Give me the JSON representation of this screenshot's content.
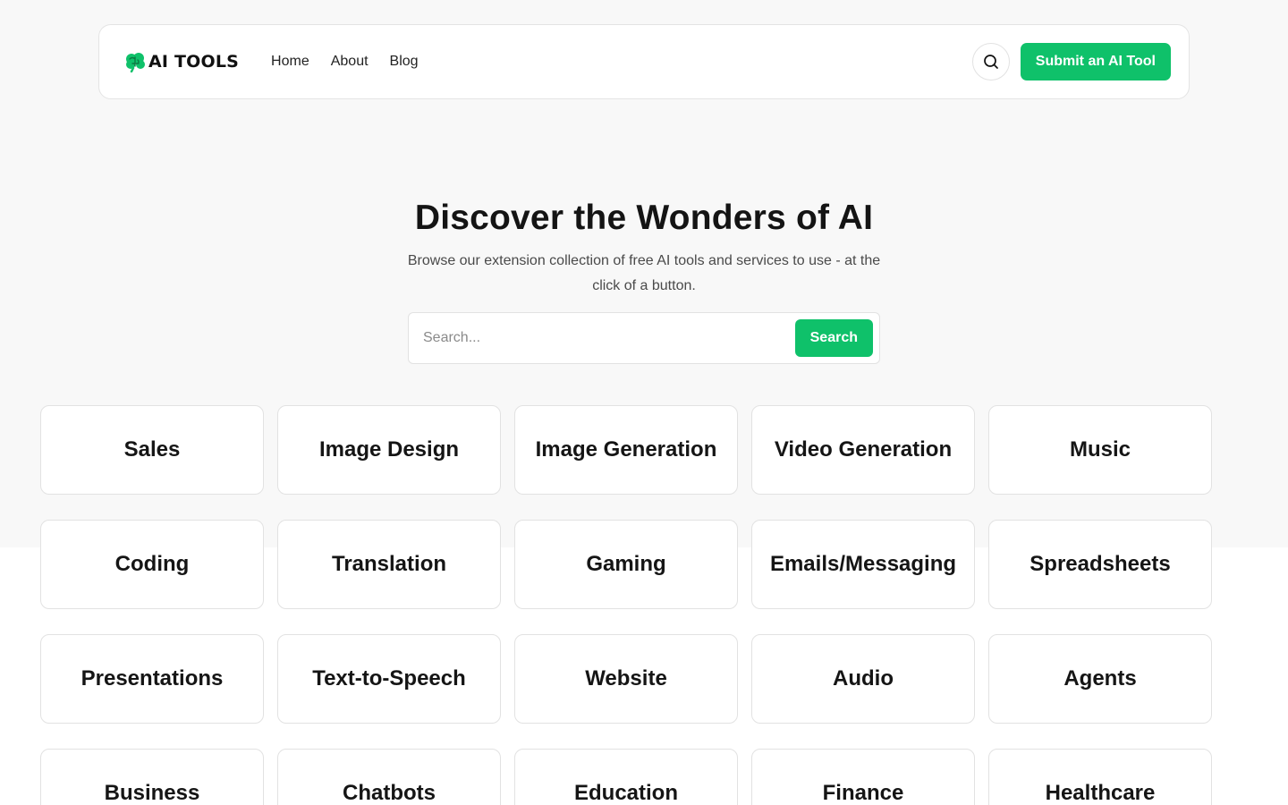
{
  "brand": {
    "name": "AI TOOLS",
    "accent": "#0fc16a"
  },
  "nav": {
    "items": [
      {
        "label": "Home"
      },
      {
        "label": "About"
      },
      {
        "label": "Blog"
      }
    ]
  },
  "header": {
    "search_icon": "search-icon",
    "submit_label": "Submit an AI Tool"
  },
  "hero": {
    "title": "Discover the Wonders of AI",
    "subtitle": "Browse our extension collection of free AI tools and services to use - at the click of a button.",
    "search_placeholder": "Search...",
    "search_button": "Search"
  },
  "categories": [
    "Sales",
    "Image Design",
    "Image Generation",
    "Video Generation",
    "Music",
    "Coding",
    "Translation",
    "Gaming",
    "Emails/Messaging",
    "Spreadsheets",
    "Presentations",
    "Text-to-Speech",
    "Website",
    "Audio",
    "Agents",
    "Business",
    "Chatbots",
    "Education",
    "Finance",
    "Healthcare"
  ]
}
